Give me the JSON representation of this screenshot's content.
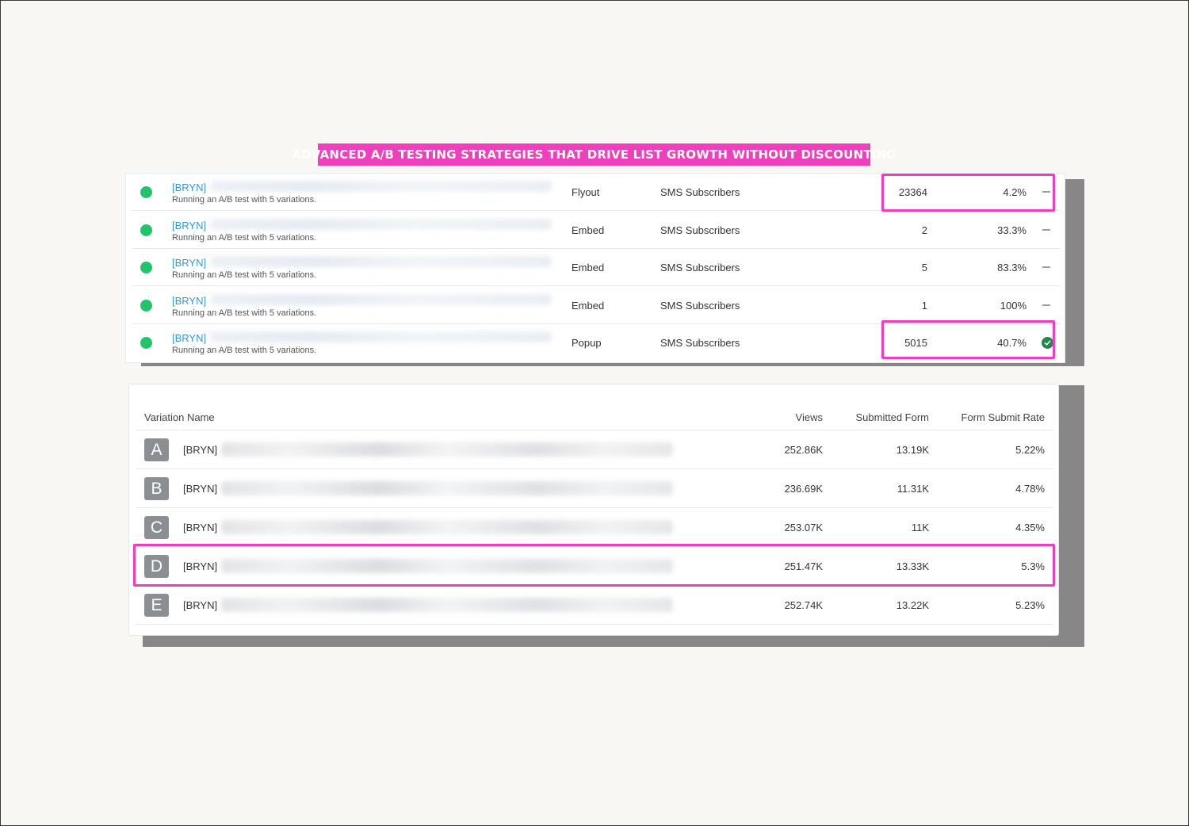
{
  "banner": "ADVANCED A/B TESTING STRATEGIES THAT DRIVE LIST GROWTH WITHOUT DISCOUNTING",
  "colors": {
    "highlight": "#ef3dbd",
    "active_dot": "#21c46b",
    "link": "#3a97cd",
    "winner": "#22884a"
  },
  "forms": [
    {
      "name": "[BRYN]",
      "desc": "Running an A/B test with 5 variations.",
      "type": "Flyout",
      "list": "SMS Subscribers",
      "count": "23364",
      "rate": "4.2%",
      "status_icon": "dash-icon"
    },
    {
      "name": "[BRYN]",
      "desc": "Running an A/B test with 5 variations.",
      "type": "Embed",
      "list": "SMS Subscribers",
      "count": "2",
      "rate": "33.3%",
      "status_icon": "dash-icon"
    },
    {
      "name": "[BRYN]",
      "desc": "Running an A/B test with 5 variations.",
      "type": "Embed",
      "list": "SMS Subscribers",
      "count": "5",
      "rate": "83.3%",
      "status_icon": "dash-icon"
    },
    {
      "name": "[BRYN]",
      "desc": "Running an A/B test with 5 variations.",
      "type": "Embed",
      "list": "SMS Subscribers",
      "count": "1",
      "rate": "100%",
      "status_icon": "dash-icon"
    },
    {
      "name": "[BRYN]",
      "desc": "Running an A/B test with 5 variations.",
      "type": "Popup",
      "list": "SMS Subscribers",
      "count": "5015",
      "rate": "40.7%",
      "status_icon": "check-icon"
    }
  ],
  "variations": {
    "headers": {
      "name": "Variation Name",
      "views": "Views",
      "submitted": "Submitted Form",
      "rate": "Form Submit Rate"
    },
    "rows": [
      {
        "letter": "A",
        "name": "[BRYN]",
        "views": "252.86K",
        "submitted": "13.19K",
        "rate": "5.22%"
      },
      {
        "letter": "B",
        "name": "[BRYN]",
        "views": "236.69K",
        "submitted": "11.31K",
        "rate": "4.78%"
      },
      {
        "letter": "C",
        "name": "[BRYN]",
        "views": "253.07K",
        "submitted": "11K",
        "rate": "4.35%"
      },
      {
        "letter": "D",
        "name": "[BRYN]",
        "views": "251.47K",
        "submitted": "13.33K",
        "rate": "5.3%"
      },
      {
        "letter": "E",
        "name": "[BRYN]",
        "views": "252.74K",
        "submitted": "13.22K",
        "rate": "5.23%"
      }
    ]
  }
}
